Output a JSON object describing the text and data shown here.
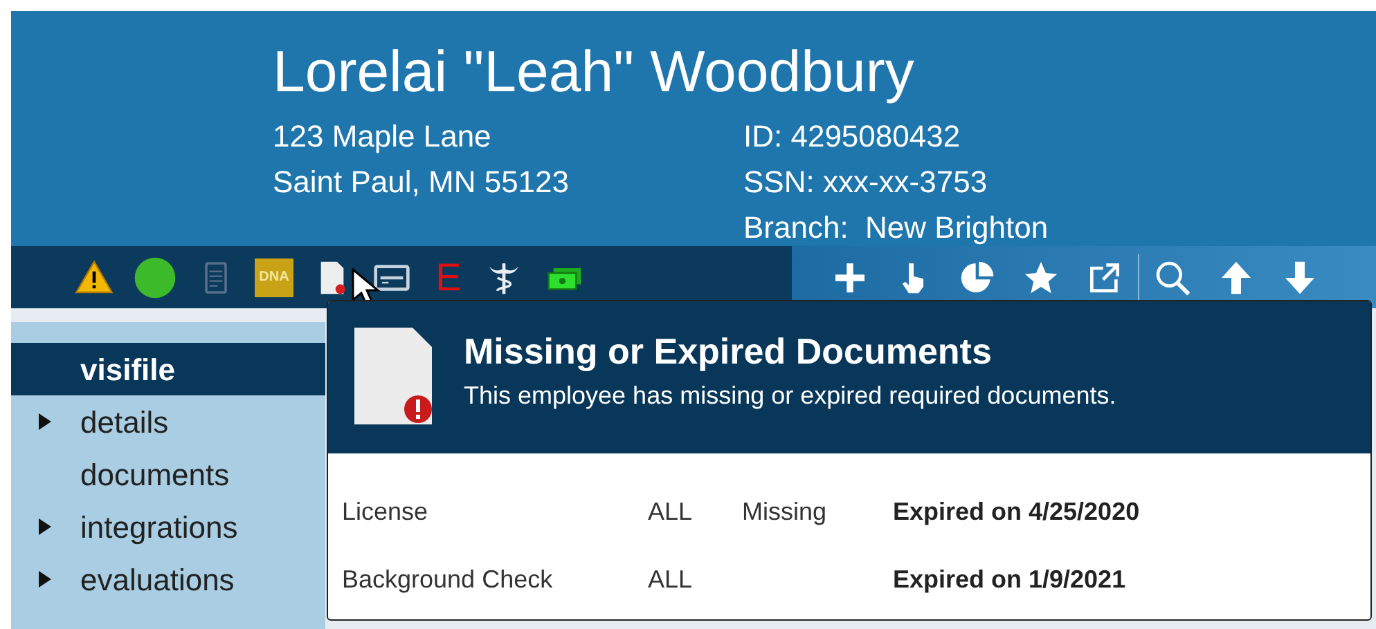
{
  "header": {
    "name": "Lorelai \"Leah\" Woodbury",
    "address_lines": [
      "123 Maple Lane",
      "Saint Paul, MN 55123"
    ],
    "id_lines": [
      "ID: 4295080432",
      "SSN: xxx-xx-3753",
      "Branch:  New Brighton"
    ]
  },
  "toolbar": {
    "dna_label": "DNA",
    "e_label": "E"
  },
  "sidebar": {
    "items": [
      {
        "label": "visifile",
        "selected": true,
        "expandable": false
      },
      {
        "label": "details",
        "selected": false,
        "expandable": true
      },
      {
        "label": "documents",
        "selected": false,
        "expandable": false
      },
      {
        "label": "integrations",
        "selected": false,
        "expandable": true
      },
      {
        "label": "evaluations",
        "selected": false,
        "expandable": true
      }
    ]
  },
  "tooltip": {
    "title": "Missing or Expired Documents",
    "subtitle": "This employee has missing or expired required documents.",
    "rows": [
      {
        "document": "License",
        "scope": "ALL",
        "status": "Missing",
        "expiry": "Expired on 4/25/2020"
      },
      {
        "document": "Background Check",
        "scope": "ALL",
        "status": "",
        "expiry": "Expired on 1/9/2021"
      }
    ]
  }
}
